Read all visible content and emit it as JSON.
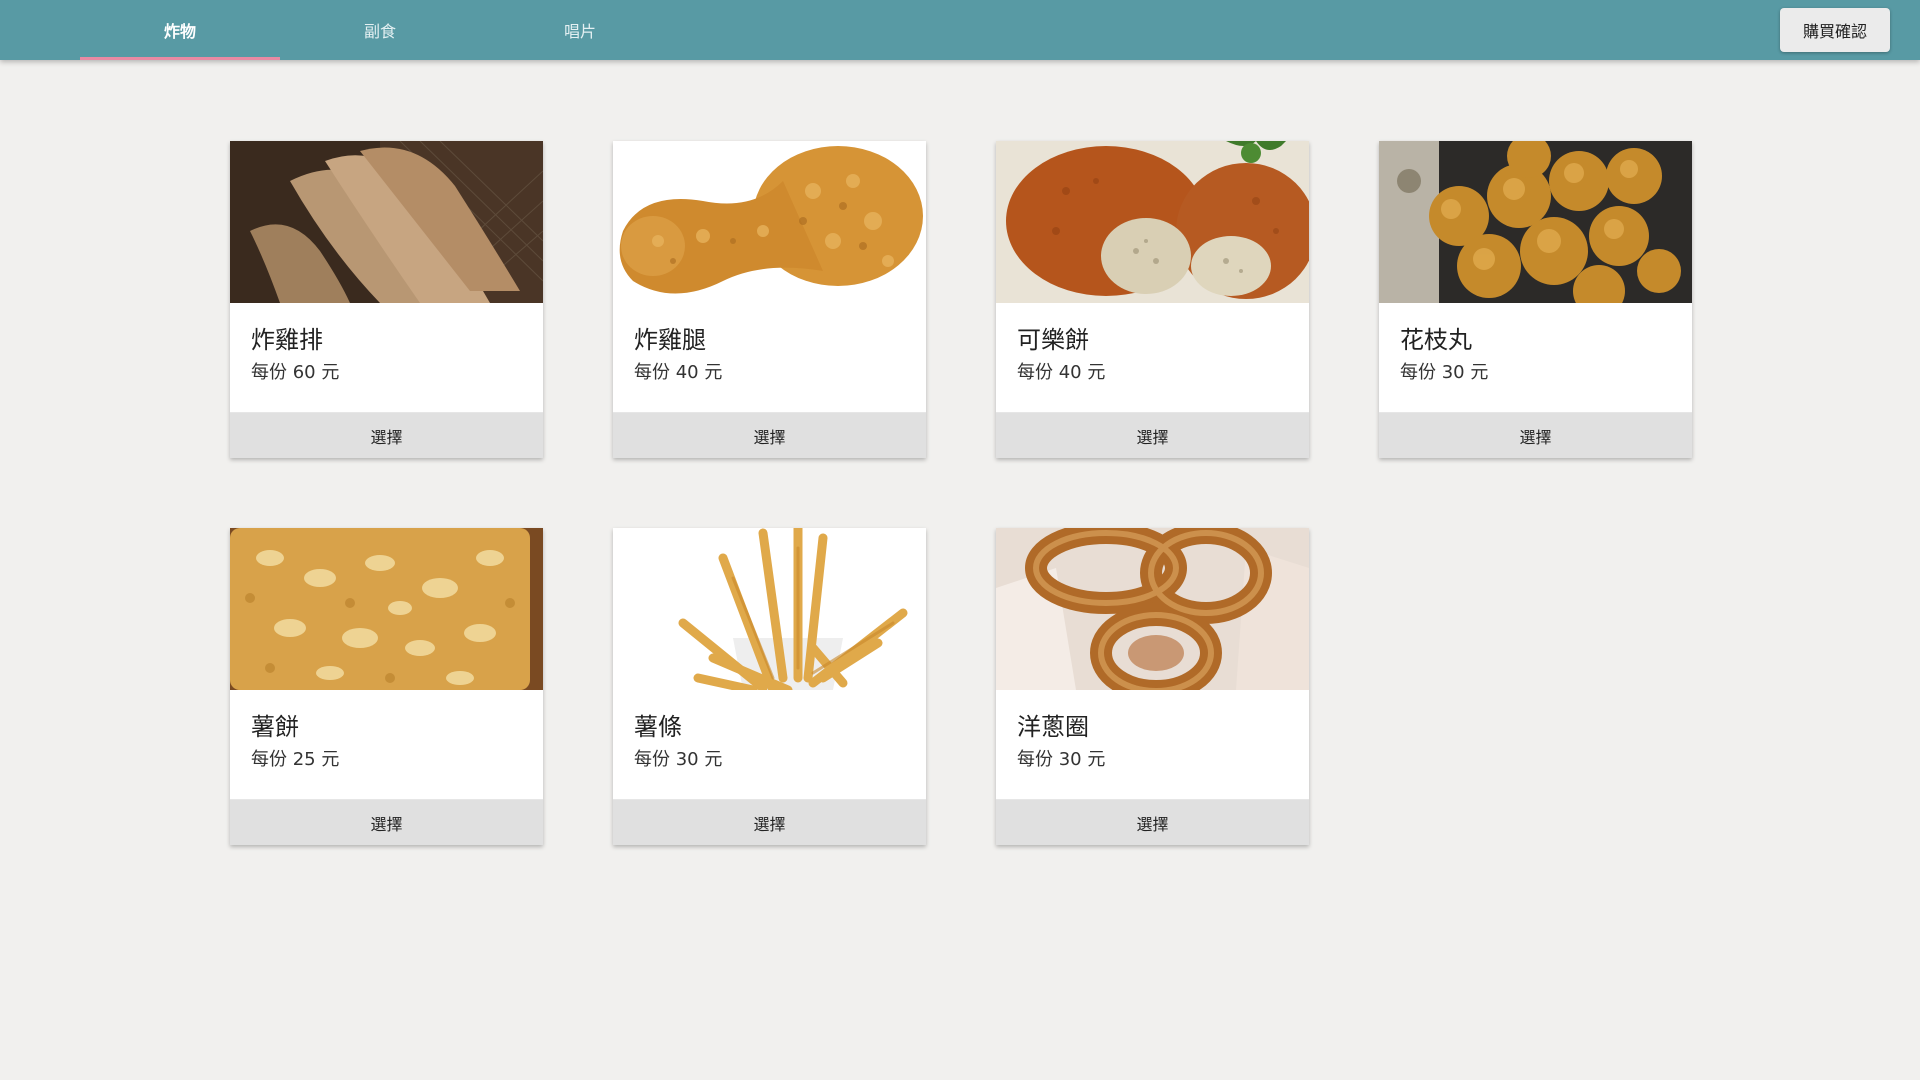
{
  "tabs": [
    {
      "label": "炸物",
      "active": true
    },
    {
      "label": "副食",
      "active": false
    },
    {
      "label": "唱片",
      "active": false
    }
  ],
  "confirm_label": "購買確認",
  "accent_color": "#589aa4",
  "indicator_color": "#e98aa3",
  "products": [
    {
      "name": "炸雞排",
      "price": "每份 60 元",
      "button": "選擇",
      "image": "fried-chicken-cutlet-photo"
    },
    {
      "name": "炸雞腿",
      "price": "每份 40 元",
      "button": "選擇",
      "image": "fried-drumstick-photo"
    },
    {
      "name": "可樂餅",
      "price": "每份 40 元",
      "button": "選擇",
      "image": "croquette-photo"
    },
    {
      "name": "花枝丸",
      "price": "每份 30 元",
      "button": "選擇",
      "image": "squid-ball-photo"
    },
    {
      "name": "薯餅",
      "price": "每份 25 元",
      "button": "選擇",
      "image": "hash-brown-photo"
    },
    {
      "name": "薯條",
      "price": "每份 30 元",
      "button": "選擇",
      "image": "french-fries-photo"
    },
    {
      "name": "洋蔥圈",
      "price": "每份 30 元",
      "button": "選擇",
      "image": "onion-rings-photo"
    }
  ]
}
